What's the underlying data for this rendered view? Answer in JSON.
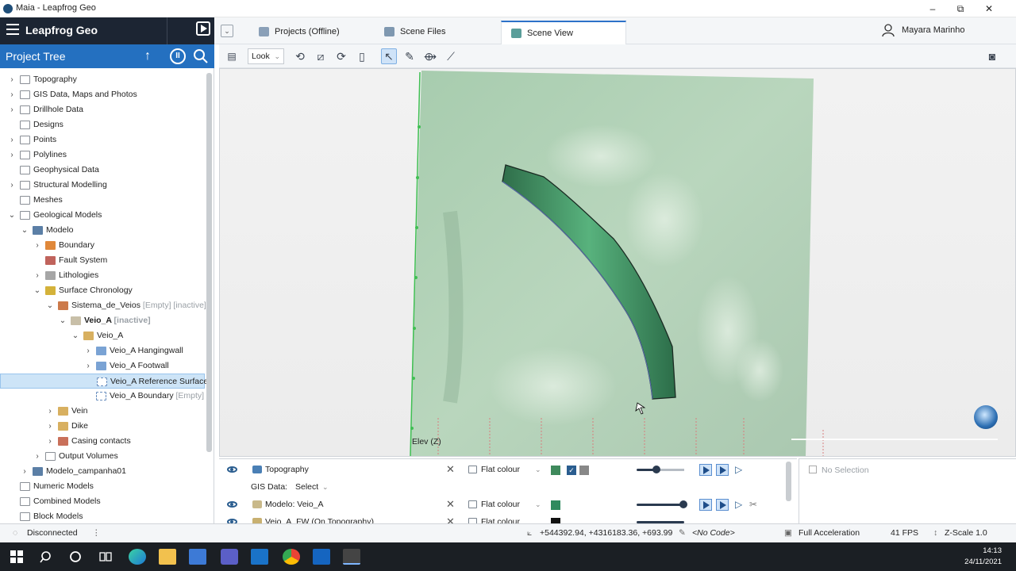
{
  "window": {
    "title": "Maia - Leapfrog Geo",
    "min": "–",
    "max": "⧉",
    "close": "✕"
  },
  "brand": {
    "name": "Leapfrog Geo"
  },
  "tabs": [
    {
      "label": "Projects (Offline)",
      "color": "#8aa0b8"
    },
    {
      "label": "Scene Files",
      "color": "#7f98b0"
    },
    {
      "label": "Scene View",
      "color": "#5a9e9a"
    }
  ],
  "user": {
    "name": "Mayara Marinho"
  },
  "project_tree": {
    "title": "Project Tree",
    "items": [
      {
        "label": "Topography",
        "depth": 0,
        "exp": ">",
        "icon": "folder"
      },
      {
        "label": "GIS Data, Maps and Photos",
        "depth": 0,
        "exp": ">",
        "icon": "folder"
      },
      {
        "label": "Drillhole Data",
        "depth": 0,
        "exp": ">",
        "icon": "folder"
      },
      {
        "label": "Designs",
        "depth": 0,
        "exp": "",
        "icon": "folder"
      },
      {
        "label": "Points",
        "depth": 0,
        "exp": ">",
        "icon": "folder"
      },
      {
        "label": "Polylines",
        "depth": 0,
        "exp": ">",
        "icon": "folder"
      },
      {
        "label": "Geophysical Data",
        "depth": 0,
        "exp": "",
        "icon": "folder"
      },
      {
        "label": "Structural Modelling",
        "depth": 0,
        "exp": ">",
        "icon": "folder"
      },
      {
        "label": "Meshes",
        "depth": 0,
        "exp": "",
        "icon": "folder"
      },
      {
        "label": "Geological Models",
        "depth": 0,
        "exp": "v",
        "icon": "folder"
      },
      {
        "label": "Modelo",
        "depth": 1,
        "exp": "v",
        "icon": "model"
      },
      {
        "label": "Boundary",
        "depth": 2,
        "exp": ">",
        "icon": "boundary"
      },
      {
        "label": "Fault System",
        "depth": 2,
        "exp": "",
        "icon": "fault"
      },
      {
        "label": "Lithologies",
        "depth": 2,
        "exp": ">",
        "icon": "litho"
      },
      {
        "label": "Surface Chronology",
        "depth": 2,
        "exp": "v",
        "icon": "chrono"
      },
      {
        "label": "Sistema_de_Veios",
        "tag": "[Empty] [inactive]",
        "depth": 3,
        "exp": "v",
        "icon": "veinsys"
      },
      {
        "label": "Veio_A",
        "tag": "[inactive]",
        "depth": 4,
        "exp": "v",
        "icon": "vein",
        "bold": true
      },
      {
        "label": "Veio_A",
        "depth": 5,
        "exp": "v",
        "icon": "veinvol"
      },
      {
        "label": "Veio_A Hangingwall",
        "depth": 6,
        "exp": ">",
        "icon": "surface"
      },
      {
        "label": "Veio_A Footwall",
        "depth": 6,
        "exp": ">",
        "icon": "surface"
      },
      {
        "label": "Veio_A Reference Surface",
        "depth": 6,
        "exp": "",
        "icon": "refsurf",
        "selected": true
      },
      {
        "label": "Veio_A Boundary",
        "tag": "[Empty]",
        "depth": 6,
        "exp": "",
        "icon": "refsurf"
      },
      {
        "label": "Vein",
        "depth": 3,
        "exp": ">",
        "icon": "veinvol"
      },
      {
        "label": "Dike",
        "depth": 3,
        "exp": ">",
        "icon": "veinvol"
      },
      {
        "label": "Casing contacts",
        "depth": 3,
        "exp": ">",
        "icon": "casing"
      },
      {
        "label": "Output Volumes",
        "depth": 2,
        "exp": ">",
        "icon": "folder"
      },
      {
        "label": "Modelo_campanha01",
        "depth": 1,
        "exp": ">",
        "icon": "model"
      },
      {
        "label": "Numeric Models",
        "depth": 0,
        "exp": "",
        "icon": "folder"
      },
      {
        "label": "Combined Models",
        "depth": 0,
        "exp": "",
        "icon": "folder"
      },
      {
        "label": "Block Models",
        "depth": 0,
        "exp": "",
        "icon": "folder"
      }
    ]
  },
  "toolbar": {
    "look_label": "Look"
  },
  "viewport": {
    "elev_label": "Elev (Z)"
  },
  "scene_list": {
    "gis_label": "GIS Data:",
    "gis_select": "Select",
    "rows": [
      {
        "name": "Topography",
        "colour": "Flat colour",
        "swatch": "#3f8a5c",
        "extra": true,
        "opacity": 0.4,
        "icon": "#4a7fb5"
      },
      {
        "name": "Modelo: Veio_A",
        "colour": "Flat colour",
        "swatch": "#2f8a5e",
        "extra": false,
        "opacity": 1.0,
        "icon": "#c9b98a"
      },
      {
        "name": "Veio_A_FW (On Topography)",
        "colour": "Flat colour",
        "swatch": "#111111",
        "extra": false,
        "opacity": 1.0,
        "icon": "#c8b070"
      }
    ]
  },
  "selection_panel": {
    "text": "No Selection"
  },
  "status": {
    "connection": "Disconnected",
    "coords": "+544392.94, +4316183.36, +693.99",
    "code": "<No Code>",
    "accel": "Full Acceleration",
    "fps": "41 FPS",
    "zscale": "Z-Scale 1.0"
  },
  "taskbar": {
    "time": "14:13",
    "date": "24/11/2021"
  },
  "colors": {
    "accent": "#2470c0",
    "header_dark": "#1c2533",
    "vein": "#3aa36b",
    "plane": "#9cc8a4"
  }
}
